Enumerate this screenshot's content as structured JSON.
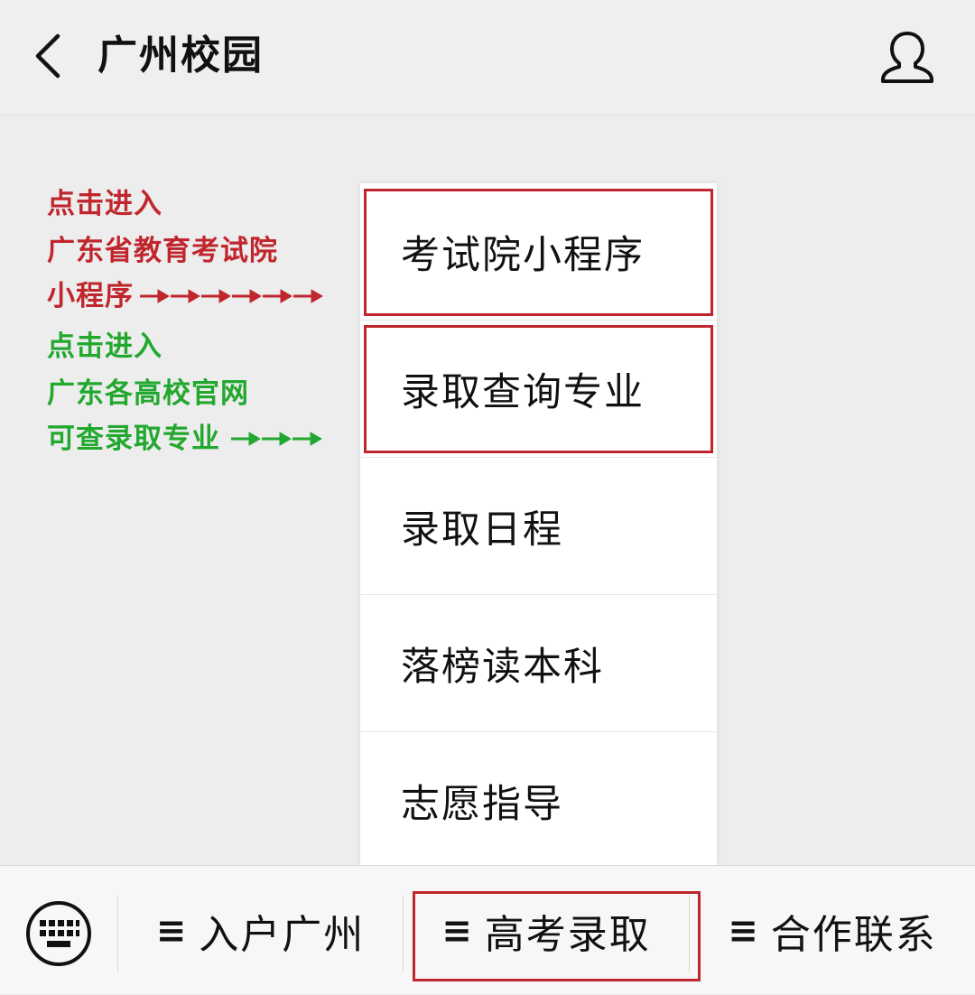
{
  "header": {
    "title": "广州校园",
    "back_icon": "chevron-left-icon",
    "profile_icon": "user-icon"
  },
  "annotations": {
    "red_lines": [
      "点击进入",
      "广东省教育考试院",
      "小程序"
    ],
    "green_lines": [
      "点击进入",
      "广东各高校官网",
      "可查录取专业"
    ],
    "red_color": "#c0262d",
    "green_color": "#22a82e"
  },
  "dropdown": {
    "items": [
      {
        "label": "考试院小程序",
        "highlighted": true
      },
      {
        "label": "录取查询专业",
        "highlighted": true
      },
      {
        "label": "录取日程",
        "highlighted": false
      },
      {
        "label": "落榜读本科",
        "highlighted": false
      },
      {
        "label": "志愿指导",
        "highlighted": false
      }
    ]
  },
  "bottom_bar": {
    "keyboard_icon": "keyboard-icon",
    "menu_symbol": "≡",
    "tabs": [
      {
        "label": "入户广州",
        "highlighted": false
      },
      {
        "label": "高考录取",
        "highlighted": true
      },
      {
        "label": "合作联系",
        "highlighted": false
      }
    ]
  }
}
